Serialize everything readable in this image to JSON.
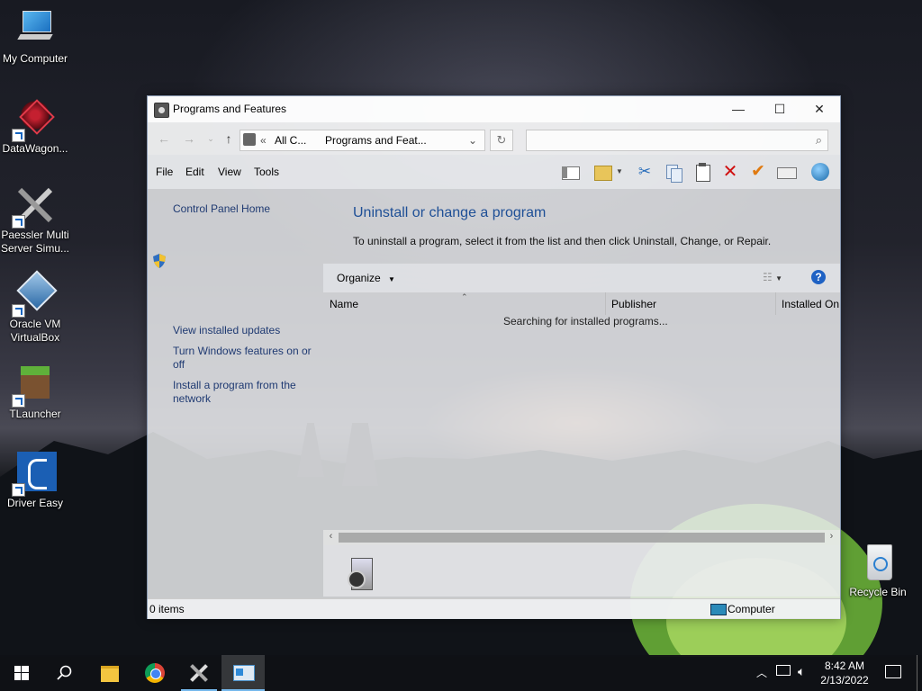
{
  "desktop": {
    "icons": [
      {
        "label": "My Computer"
      },
      {
        "label": "DataWagon..."
      },
      {
        "label": "Paessler Multi Server Simu..."
      },
      {
        "label": "Oracle VM VirtualBox"
      },
      {
        "label": "TLauncher"
      },
      {
        "label": "Driver Easy"
      },
      {
        "label": "Recycle Bin"
      }
    ]
  },
  "window": {
    "title": "Programs and Features",
    "controls": {
      "minimize": "—",
      "maximize": "☐",
      "close": "✕"
    },
    "address": {
      "prefix": "«",
      "segment1": "All C...",
      "segment2": "Programs and Feat..."
    },
    "menu": [
      "File",
      "Edit",
      "View",
      "Tools"
    ],
    "left_links": {
      "home": "Control Panel Home",
      "updates": "View installed updates",
      "features": "Turn Windows features on or off",
      "install": "Install a program from the network"
    },
    "heading": "Uninstall or change a program",
    "description": "To uninstall a program, select it from the list and then click Uninstall, Change, or Repair.",
    "organize": "Organize",
    "columns": {
      "name": "Name",
      "publisher": "Publisher",
      "installed_on": "Installed On"
    },
    "searching": "Searching for installed programs...",
    "status": {
      "items": "0 items",
      "location": "Computer"
    }
  },
  "taskbar": {
    "time": "8:42 AM",
    "date": "2/13/2022"
  },
  "colors": {
    "link": "#1f3a72",
    "heading": "#1e4f96",
    "taskbar": "#101216",
    "accent": "#76b9ed"
  }
}
